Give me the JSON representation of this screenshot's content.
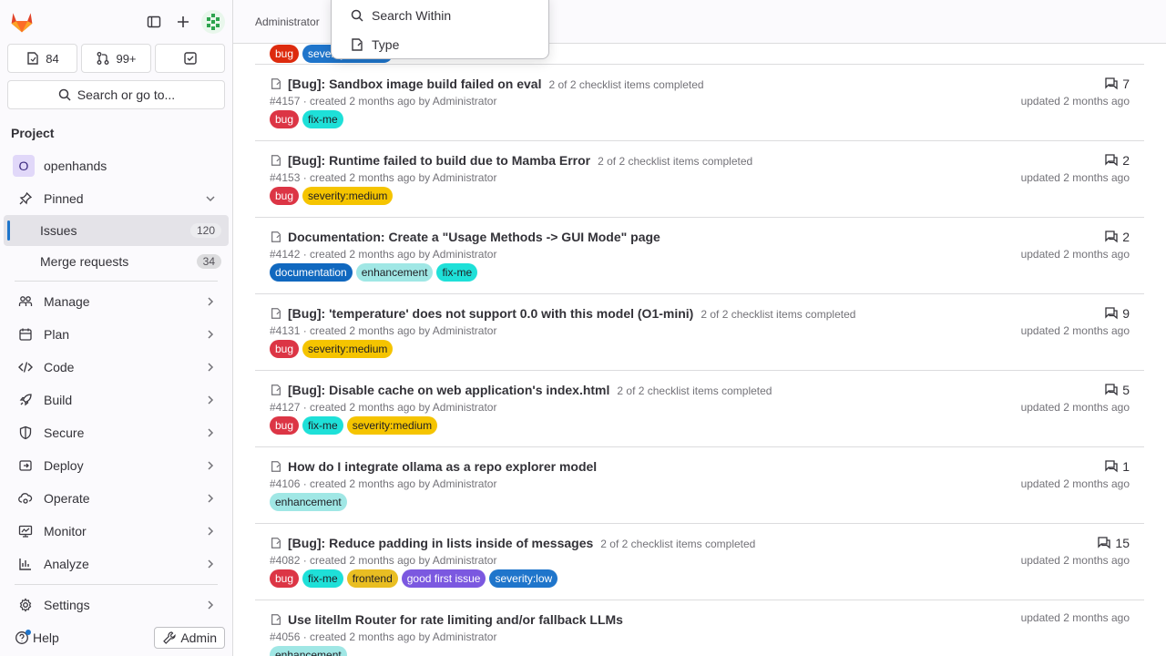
{
  "sidebar": {
    "counts": [
      {
        "icon": "issues-icon",
        "value": "84"
      },
      {
        "icon": "merge-request-icon",
        "value": "99+"
      },
      {
        "icon": "todo-icon",
        "value": ""
      }
    ],
    "search_label": "Search or go to...",
    "section_title": "Project",
    "project_name": "openhands",
    "project_initial": "O",
    "pinned_label": "Pinned",
    "pinned_items": [
      {
        "label": "Issues",
        "count": "120"
      },
      {
        "label": "Merge requests",
        "count": "34"
      }
    ],
    "nav_items": [
      {
        "label": "Manage",
        "icon": "users-icon"
      },
      {
        "label": "Plan",
        "icon": "calendar-icon"
      },
      {
        "label": "Code",
        "icon": "code-icon"
      },
      {
        "label": "Build",
        "icon": "rocket-icon"
      },
      {
        "label": "Secure",
        "icon": "shield-icon"
      },
      {
        "label": "Deploy",
        "icon": "deploy-icon"
      },
      {
        "label": "Operate",
        "icon": "cloud-gear-icon"
      },
      {
        "label": "Monitor",
        "icon": "monitor-icon"
      },
      {
        "label": "Analyze",
        "icon": "chart-icon"
      }
    ],
    "settings_label": "Settings",
    "help_label": "Help",
    "admin_label": "Admin"
  },
  "topbar": {
    "breadcrumb": "Administrator"
  },
  "dropdown": {
    "items": [
      {
        "label": "Search Within",
        "icon": "search-icon"
      },
      {
        "label": "Type",
        "icon": "issue-type-icon"
      }
    ]
  },
  "colors": {
    "bug": "#dd2b0e",
    "fix-me": "#1aaa55",
    "severity:medium": "#f5c400",
    "documentation": "#1068bf",
    "enhancement": "#a0e7e5",
    "frontend": "#e9be22",
    "good first issue": "#6b4fbb",
    "severity:low": "#1f75cb"
  },
  "issues": [
    {
      "partial": true,
      "labels": [
        "bug",
        "severity:medium"
      ]
    },
    {
      "title": "[Bug]: Sandbox image build failed on eval",
      "checklist": "2 of 2 checklist items completed",
      "meta": "#4157 · created 2 months ago by Administrator",
      "labels": [
        "bug",
        "fix-me"
      ],
      "comments": "7",
      "updated": "updated 2 months ago"
    },
    {
      "title": "[Bug]: Runtime failed to build due to Mamba Error",
      "checklist": "2 of 2 checklist items completed",
      "meta": "#4153 · created 2 months ago by Administrator",
      "labels": [
        "bug",
        "severity:medium"
      ],
      "comments": "2",
      "updated": "updated 2 months ago"
    },
    {
      "title": "Documentation: Create a \"Usage Methods -> GUI Mode\" page",
      "checklist": "",
      "meta": "#4142 · created 2 months ago by Administrator",
      "labels": [
        "documentation",
        "enhancement",
        "fix-me"
      ],
      "comments": "2",
      "updated": "updated 2 months ago"
    },
    {
      "title": "[Bug]: 'temperature' does not support 0.0 with this model (O1-mini)",
      "checklist": "2 of 2 checklist items completed",
      "meta": "#4131 · created 2 months ago by Administrator",
      "labels": [
        "bug",
        "severity:medium"
      ],
      "comments": "9",
      "updated": "updated 2 months ago"
    },
    {
      "title": "[Bug]: Disable cache on web application's index.html",
      "checklist": "2 of 2 checklist items completed",
      "meta": "#4127 · created 2 months ago by Administrator",
      "labels": [
        "bug",
        "fix-me",
        "severity:medium"
      ],
      "comments": "5",
      "updated": "updated 2 months ago"
    },
    {
      "title": "How do I integrate ollama as a repo explorer model",
      "checklist": "",
      "meta": "#4106 · created 2 months ago by Administrator",
      "labels": [
        "enhancement"
      ],
      "comments": "1",
      "updated": "updated 2 months ago"
    },
    {
      "title": "[Bug]: Reduce padding in lists inside of messages",
      "checklist": "2 of 2 checklist items completed",
      "meta": "#4082 · created 2 months ago by Administrator",
      "labels": [
        "bug",
        "fix-me",
        "frontend",
        "good first issue",
        "severity:low"
      ],
      "comments": "15",
      "updated": "updated 2 months ago"
    },
    {
      "title": "Use litellm Router for rate limiting and/or fallback LLMs",
      "checklist": "",
      "meta": "#4056 · created 2 months ago by Administrator",
      "labels": [
        "enhancement"
      ],
      "comments": "",
      "updated": "updated 2 months ago"
    }
  ]
}
